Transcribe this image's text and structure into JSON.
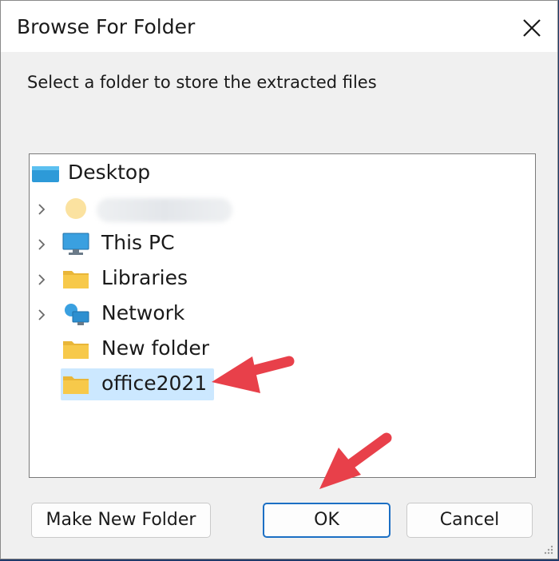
{
  "window": {
    "title": "Browse For Folder"
  },
  "instruction": "Select a folder to store the extracted files",
  "tree": {
    "root": {
      "label": "Desktop",
      "icon": "desktop-icon"
    },
    "items": [
      {
        "label": "",
        "icon": "user-folder-icon",
        "expandable": true
      },
      {
        "label": "This PC",
        "icon": "computer-icon",
        "expandable": true
      },
      {
        "label": "Libraries",
        "icon": "folder-icon",
        "expandable": true
      },
      {
        "label": "Network",
        "icon": "network-icon",
        "expandable": true
      },
      {
        "label": "New folder",
        "icon": "folder-icon",
        "expandable": false
      },
      {
        "label": "office2021",
        "icon": "folder-icon",
        "expandable": false,
        "selected": true
      }
    ]
  },
  "buttons": {
    "make_new_folder": "Make New Folder",
    "ok": "OK",
    "cancel": "Cancel"
  },
  "colors": {
    "selection": "#cce8ff",
    "annotation_arrow": "#e8404a",
    "primary_border": "#1c6fc4",
    "folder": "#f7c94a"
  }
}
